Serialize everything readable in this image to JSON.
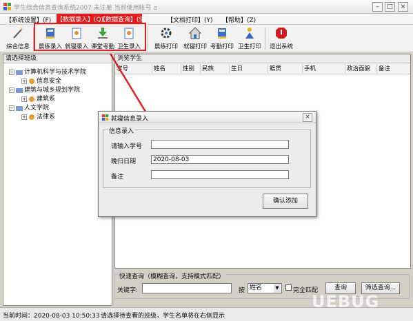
{
  "window": {
    "title": "学生综合信息查询系统2007  未注册  当前使用帐号 a"
  },
  "menu": [
    {
      "label": "【系统设置】(F)"
    },
    {
      "label": "【数据录入】(Q)"
    },
    {
      "label": "【数据查询】(S)"
    },
    {
      "label": "【文档打印】(Y)"
    },
    {
      "label": "【帮助】(Z)"
    }
  ],
  "toolbar": [
    {
      "label": "综合信息",
      "icon": "magic-wand-icon"
    },
    {
      "label": "晨练录入",
      "icon": "book-icon"
    },
    {
      "label": "就寝录入",
      "icon": "document-icon"
    },
    {
      "label": "课堂考勤",
      "icon": "download-icon"
    },
    {
      "label": "卫生录入",
      "icon": "document-icon"
    },
    {
      "label": "晨练打印",
      "icon": "gear-icon"
    },
    {
      "label": "就寝打印",
      "icon": "house-icon"
    },
    {
      "label": "考勤打印",
      "icon": "book-icon"
    },
    {
      "label": "卫生打印",
      "icon": "person-icon"
    },
    {
      "label": "退出系统",
      "icon": "stop-icon"
    }
  ],
  "left_panel": {
    "title": "请选择班级",
    "tree": [
      {
        "label": "计算机科学与技术学院",
        "level": 0
      },
      {
        "label": "信息安全",
        "level": 1
      },
      {
        "label": "建筑与城乡规划学院",
        "level": 0
      },
      {
        "label": "建筑系",
        "level": 1
      },
      {
        "label": "人文学院",
        "level": 0
      },
      {
        "label": "法律系",
        "level": 1
      }
    ]
  },
  "right_panel": {
    "title": "浏览学生",
    "columns": [
      "学号",
      "姓名",
      "性别",
      "民族",
      "生日",
      "籍贯",
      "手机",
      "政治面貌",
      "备注"
    ]
  },
  "quick_search": {
    "legend": "快速查询（模糊查询，支持模式匹配）",
    "keyword_label": "关键字:",
    "keyword_value": "",
    "by_label": "按",
    "field_select": "姓名",
    "exact_match_label": "完全匹配",
    "search_button": "查询",
    "filter_button": "筛选查询..."
  },
  "dialog": {
    "title": "就寝信息录入",
    "group_legend": "信息录入",
    "student_id_label": "请输入学号",
    "student_id_value": "",
    "date_label": "晚归日期",
    "date_value": "2020-08-03",
    "remark_label": "备注",
    "remark_value": "",
    "confirm_button": "确认添加"
  },
  "status": {
    "time": "当前时间：2020-08-03 10:50:33",
    "hint": "请选择待查看的班级，学生名单将在右侧显示"
  },
  "watermark": "UEBUG",
  "colors": {
    "highlight": "#e02020",
    "background": "#d4d0c8"
  }
}
